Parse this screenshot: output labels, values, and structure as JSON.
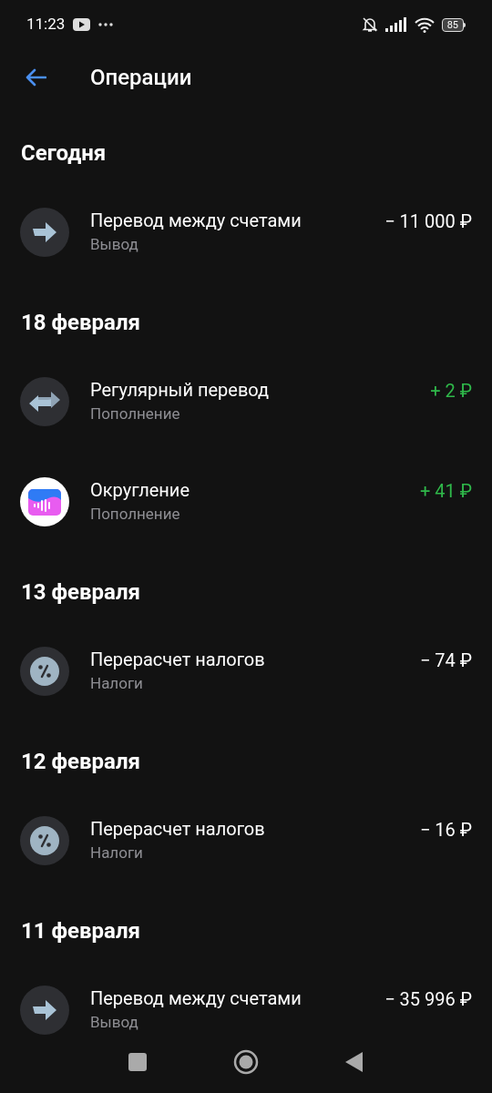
{
  "status_bar": {
    "time": "11:23",
    "battery": "85"
  },
  "header": {
    "title": "Операции"
  },
  "sections": [
    {
      "date": "Сегодня",
      "operations": [
        {
          "kind": "transfer",
          "title": "Перевод между счетами",
          "subtitle": "Вывод",
          "amount": "− 11 000 ₽",
          "positive": false
        }
      ]
    },
    {
      "date": "18 февраля",
      "operations": [
        {
          "kind": "recurring",
          "title": "Регулярный перевод",
          "subtitle": "Пополнение",
          "amount": "+ 2 ₽",
          "positive": true
        },
        {
          "kind": "app",
          "title": "Округление",
          "subtitle": "Пополнение",
          "amount": "+ 41 ₽",
          "positive": true
        }
      ]
    },
    {
      "date": "13 февраля",
      "operations": [
        {
          "kind": "tax",
          "title": "Перерасчет налогов",
          "subtitle": "Налоги",
          "amount": "− 74 ₽",
          "positive": false
        }
      ]
    },
    {
      "date": "12 февраля",
      "operations": [
        {
          "kind": "tax",
          "title": "Перерасчет налогов",
          "subtitle": "Налоги",
          "amount": "− 16 ₽",
          "positive": false
        }
      ]
    },
    {
      "date": "11 февраля",
      "operations": [
        {
          "kind": "transfer",
          "title": "Перевод между счетами",
          "subtitle": "Вывод",
          "amount": "− 35 996 ₽",
          "positive": false
        }
      ]
    }
  ]
}
